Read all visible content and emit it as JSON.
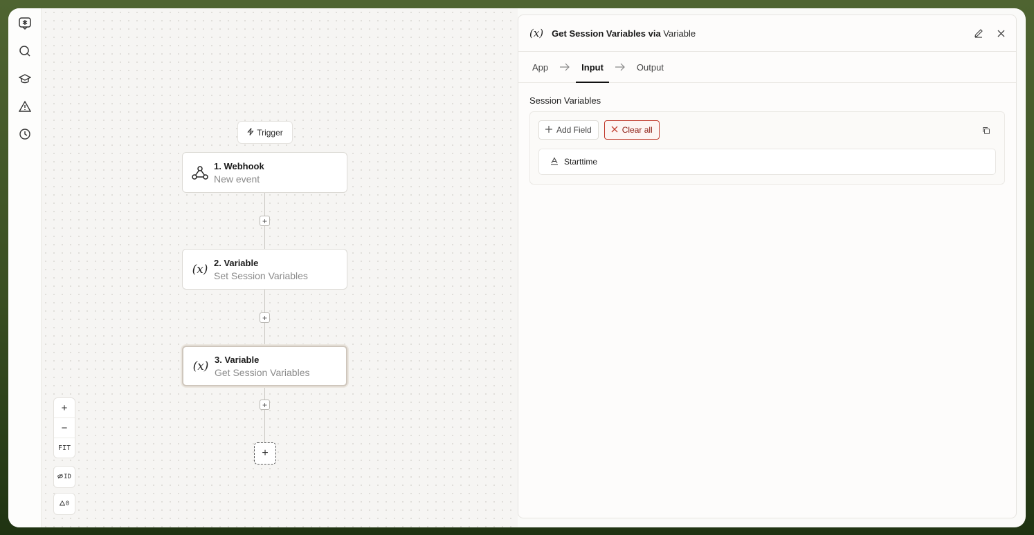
{
  "sidebar": {
    "items": [
      {
        "name": "logo-icon"
      },
      {
        "name": "search-icon"
      },
      {
        "name": "learn-icon"
      },
      {
        "name": "warning-icon"
      },
      {
        "name": "history-icon"
      }
    ]
  },
  "canvas": {
    "trigger_label": "Trigger",
    "nodes": [
      {
        "title": "1. Webhook",
        "subtitle": "New event",
        "icon": "webhook-icon"
      },
      {
        "title": "2. Variable",
        "subtitle": "Set Session Variables",
        "icon": "variable-icon"
      },
      {
        "title": "3. Variable",
        "subtitle": "Get Session Variables",
        "icon": "variable-icon",
        "selected": true
      }
    ],
    "zoom_in": "+",
    "zoom_out": "−",
    "fit_label": "FIT",
    "id_label": "ID",
    "warnings_count": "0"
  },
  "panel": {
    "icon_text": "(x)",
    "title_bold": "Get Session Variables via",
    "title_app": "Variable",
    "tabs": [
      {
        "label": "App",
        "active": false
      },
      {
        "label": "Input",
        "active": true
      },
      {
        "label": "Output",
        "active": false
      }
    ],
    "section_label": "Session Variables",
    "add_field_label": "Add Field",
    "clear_all_label": "Clear all",
    "fields": [
      {
        "name": "Starttime",
        "type_icon": "text-type-icon"
      }
    ]
  },
  "colors": {
    "frame_green": "#4f6431",
    "danger": "#c0392b",
    "canvas_bg": "#f6f5f3"
  }
}
